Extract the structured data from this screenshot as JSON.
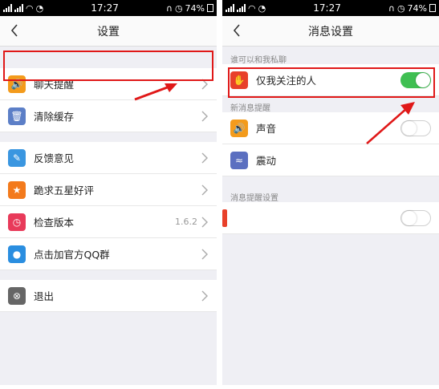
{
  "status_bar": {
    "time": "17:27",
    "battery": "74%"
  },
  "left": {
    "title": "设置",
    "items_group1": [
      {
        "label": "聊天提醒",
        "icon": "speaker-icon",
        "color": "#f39b1c"
      },
      {
        "label": "清除缓存",
        "icon": "trash-icon",
        "color": "#5c7fc7"
      }
    ],
    "items_group2": [
      {
        "label": "反馈意见",
        "icon": "edit-icon",
        "color": "#3a96e0"
      },
      {
        "label": "跪求五星好评",
        "icon": "star-icon",
        "color": "#f37a1c"
      },
      {
        "label": "检查版本",
        "icon": "clock-icon",
        "color": "#e83a5a",
        "value": "1.6.2"
      },
      {
        "label": "点击加官方QQ群",
        "icon": "qq-icon",
        "color": "#2a8ee0"
      }
    ],
    "items_group3": [
      {
        "label": "退出",
        "icon": "close-circle-icon",
        "color": "#666666"
      }
    ]
  },
  "right": {
    "title": "消息设置",
    "section1_title": "谁可以和我私聊",
    "section1_item": {
      "label": "仅我关注的人",
      "icon": "hand-icon",
      "color": "#e8402a",
      "toggle": true
    },
    "section2_title": "新消息提醒",
    "section2_items": [
      {
        "label": "声音",
        "icon": "speaker-icon",
        "color": "#f39b1c",
        "toggle": false
      },
      {
        "label": "震动",
        "icon": "vibrate-icon",
        "color": "#5b6fc0"
      }
    ],
    "section3_title": "消息提醒设置",
    "section3_item": {
      "label": "",
      "icon": "red-bar-icon",
      "color": "#e8402a",
      "toggle": false
    }
  },
  "colors": {
    "highlight": "#e01818",
    "toggle_on": "#3fbf52"
  }
}
